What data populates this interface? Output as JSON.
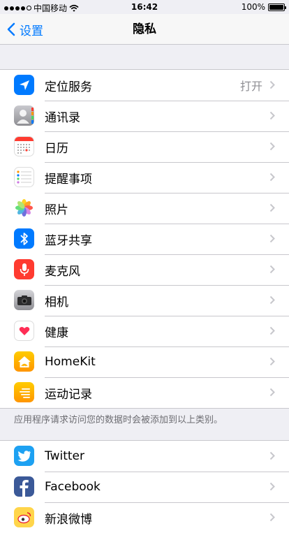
{
  "status_bar": {
    "carrier": "中国移动",
    "time": "16:42",
    "battery": "100%"
  },
  "nav": {
    "back_label": "设置",
    "title": "隐私"
  },
  "privacy_items": [
    {
      "label": "定位服务",
      "value": "打开",
      "icon": "location-arrow-icon",
      "color": "#007aff"
    },
    {
      "label": "通讯录",
      "value": "",
      "icon": "contacts-icon",
      "color": "#8e8e93"
    },
    {
      "label": "日历",
      "value": "",
      "icon": "calendar-icon",
      "color": "#ffffff"
    },
    {
      "label": "提醒事项",
      "value": "",
      "icon": "reminders-icon",
      "color": "#ffffff"
    },
    {
      "label": "照片",
      "value": "",
      "icon": "photos-icon",
      "color": "#ffffff"
    },
    {
      "label": "蓝牙共享",
      "value": "",
      "icon": "bluetooth-icon",
      "color": "#007aff"
    },
    {
      "label": "麦克风",
      "value": "",
      "icon": "microphone-icon",
      "color": "#ff3b30"
    },
    {
      "label": "相机",
      "value": "",
      "icon": "camera-icon",
      "color": "#8e8e93"
    },
    {
      "label": "健康",
      "value": "",
      "icon": "health-heart-icon",
      "color": "#ffffff"
    },
    {
      "label": "HomeKit",
      "value": "",
      "icon": "homekit-icon",
      "color": "#ffb300"
    },
    {
      "label": "运动记录",
      "value": "",
      "icon": "motion-activity-icon",
      "color": "#ff9500"
    }
  ],
  "footer_note": "应用程序请求访问您的数据时会被添加到以上类别。",
  "social_items": [
    {
      "label": "Twitter",
      "icon": "twitter-icon",
      "color": "#1da1f2"
    },
    {
      "label": "Facebook",
      "icon": "facebook-icon",
      "color": "#3b5998"
    },
    {
      "label": "新浪微博",
      "icon": "weibo-icon",
      "color": "#ffd54a"
    }
  ]
}
